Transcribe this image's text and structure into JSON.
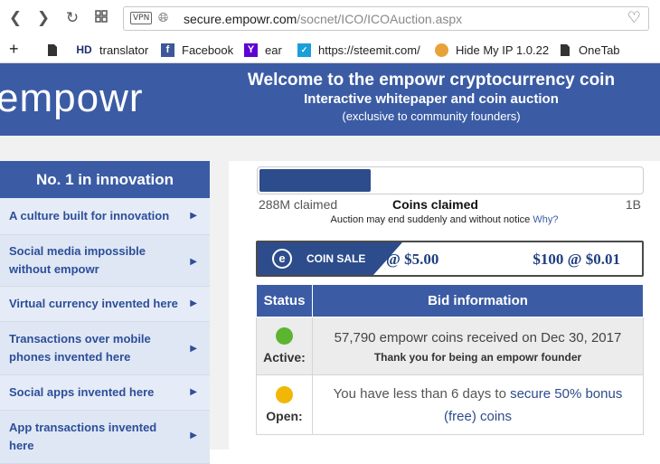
{
  "browser": {
    "vpn_badge": "VPN",
    "url_domain": "secure.empowr.com",
    "url_path": "/socnet/ICO/ICOAuction.aspx",
    "bookmarks": [
      {
        "label": "translator",
        "icon": "HD"
      },
      {
        "label": "Facebook",
        "icon": "f"
      },
      {
        "label": "ear",
        "icon": "Y"
      },
      {
        "label": "https://steemit.com/",
        "icon": "steemit-icon"
      },
      {
        "label": "Hide My IP 1.0.22",
        "icon": "hide-ip-icon"
      },
      {
        "label": "OneTab",
        "icon": "onetab-icon"
      }
    ]
  },
  "header": {
    "logo": "empowr",
    "title": "Welcome to the empowr cryptocurrency coin",
    "subtitle": "Interactive whitepaper and coin auction",
    "note": "(exclusive to community founders)"
  },
  "sidebar": {
    "heading": "No. 1 in innovation",
    "items": [
      {
        "label": "A culture built for innovation"
      },
      {
        "label": "Social media impossible without empowr"
      },
      {
        "label": "Virtual currency invented here"
      },
      {
        "label": "Transactions over mobile phones invented here"
      },
      {
        "label": "Social apps invented here"
      },
      {
        "label": "App transactions invented here"
      }
    ]
  },
  "claims": {
    "progress_fraction": 0.288,
    "left_label": "288M claimed",
    "center_label": "Coins claimed",
    "right_label": "1B",
    "auction_note": "Auction may end suddenly and without notice",
    "why_link": "Why?"
  },
  "coin_sale": {
    "logo_letter": "e",
    "label": "COIN SALE",
    "price_1": "@ $5.00",
    "price_2": "$100 @ $0.01"
  },
  "bid_table": {
    "col_status": "Status",
    "col_info": "Bid information",
    "rows": [
      {
        "status": "Active:",
        "dot_color": "#5cb531",
        "line1": "57,790 empowr coins received on Dec 30, 2017",
        "line2": "Thank you for being an empowr founder"
      },
      {
        "status": "Open:",
        "dot_color": "#f2b705",
        "line1_a": "You have less than 6 days to",
        "line1_link": "secure 50% bonus (free) coins"
      }
    ]
  },
  "colors": {
    "brand_blue": "#3b5ca5",
    "dark_blue": "#2d4c8c"
  }
}
